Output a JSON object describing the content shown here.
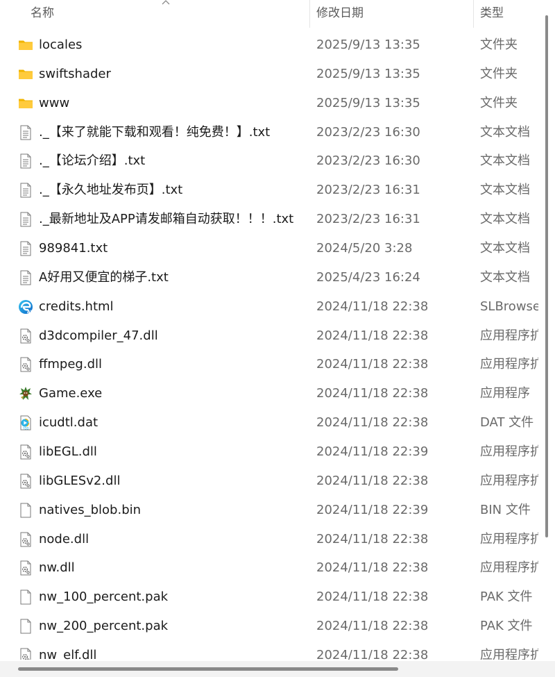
{
  "columns": {
    "name": "名称",
    "date": "修改日期",
    "type": "类型"
  },
  "files": [
    {
      "name": "locales",
      "date": "2025/9/13 13:35",
      "type": "文件夹",
      "icon": "folder-icon"
    },
    {
      "name": "swiftshader",
      "date": "2025/9/13 13:35",
      "type": "文件夹",
      "icon": "folder-icon"
    },
    {
      "name": "www",
      "date": "2025/9/13 13:35",
      "type": "文件夹",
      "icon": "folder-icon"
    },
    {
      "name": "._【来了就能下载和观看！纯免费！】.txt",
      "date": "2023/2/23 16:30",
      "type": "文本文档",
      "icon": "text-file-icon"
    },
    {
      "name": "._【论坛介绍】.txt",
      "date": "2023/2/23 16:30",
      "type": "文本文档",
      "icon": "text-file-icon"
    },
    {
      "name": "._【永久地址发布页】.txt",
      "date": "2023/2/23 16:31",
      "type": "文本文档",
      "icon": "text-file-icon"
    },
    {
      "name": "._最新地址及APP请发邮箱自动获取！！！.txt",
      "date": "2023/2/23 16:31",
      "type": "文本文档",
      "icon": "text-file-icon"
    },
    {
      "name": "989841.txt",
      "date": "2024/5/20 3:28",
      "type": "文本文档",
      "icon": "text-file-icon"
    },
    {
      "name": "A好用又便宜的梯子.txt",
      "date": "2025/4/23 16:24",
      "type": "文本文档",
      "icon": "text-file-icon"
    },
    {
      "name": "credits.html",
      "date": "2024/11/18 22:38",
      "type": "SLBrowser",
      "icon": "browser-html-icon"
    },
    {
      "name": "d3dcompiler_47.dll",
      "date": "2024/11/18 22:38",
      "type": "应用程序扩",
      "icon": "dll-file-icon"
    },
    {
      "name": "ffmpeg.dll",
      "date": "2024/11/18 22:38",
      "type": "应用程序扩",
      "icon": "dll-file-icon"
    },
    {
      "name": "Game.exe",
      "date": "2024/11/18 22:38",
      "type": "应用程序",
      "icon": "game-exe-icon"
    },
    {
      "name": "icudtl.dat",
      "date": "2024/11/18 22:38",
      "type": "DAT 文件",
      "icon": "media-dat-icon"
    },
    {
      "name": "libEGL.dll",
      "date": "2024/11/18 22:39",
      "type": "应用程序扩",
      "icon": "dll-file-icon"
    },
    {
      "name": "libGLESv2.dll",
      "date": "2024/11/18 22:38",
      "type": "应用程序扩",
      "icon": "dll-file-icon"
    },
    {
      "name": "natives_blob.bin",
      "date": "2024/11/18 22:39",
      "type": "BIN 文件",
      "icon": "blank-file-icon"
    },
    {
      "name": "node.dll",
      "date": "2024/11/18 22:38",
      "type": "应用程序扩",
      "icon": "dll-file-icon"
    },
    {
      "name": "nw.dll",
      "date": "2024/11/18 22:38",
      "type": "应用程序扩",
      "icon": "dll-file-icon"
    },
    {
      "name": "nw_100_percent.pak",
      "date": "2024/11/18 22:38",
      "type": "PAK 文件",
      "icon": "blank-file-icon"
    },
    {
      "name": "nw_200_percent.pak",
      "date": "2024/11/18 22:38",
      "type": "PAK 文件",
      "icon": "blank-file-icon"
    },
    {
      "name": "nw_elf.dll",
      "date": "2024/11/18 22:38",
      "type": "应用程序扩",
      "icon": "dll-file-icon"
    }
  ]
}
